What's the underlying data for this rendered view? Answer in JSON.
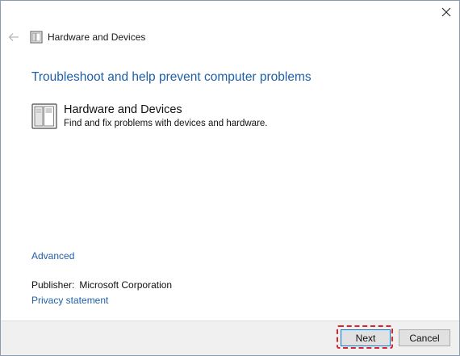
{
  "window": {
    "title": "Hardware and Devices"
  },
  "main": {
    "heading": "Troubleshoot and help prevent computer problems",
    "item": {
      "title": "Hardware and Devices",
      "description": "Find and fix problems with devices and hardware."
    },
    "advanced_link": "Advanced",
    "publisher_label": "Publisher:",
    "publisher_value": "Microsoft Corporation",
    "privacy_link": "Privacy statement"
  },
  "footer": {
    "next_label": "Next",
    "cancel_label": "Cancel"
  },
  "colors": {
    "accent": "#1f5fa8",
    "highlight": "#d9232e",
    "footer_bg": "#f0f0f0"
  },
  "icons": {
    "close": "close-icon",
    "back": "back-arrow-icon",
    "device": "hardware-device-icon"
  }
}
